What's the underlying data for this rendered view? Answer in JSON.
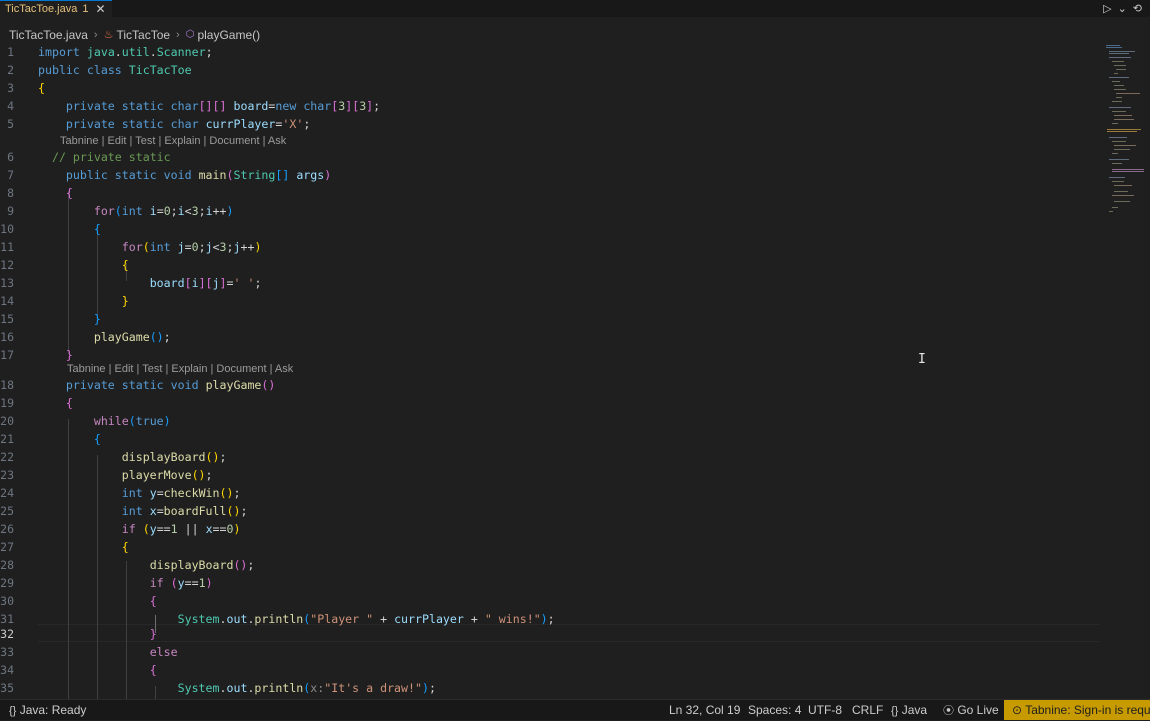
{
  "tab": {
    "title": "TicTacToe.java",
    "badge": "1",
    "close": "✕"
  },
  "toolbar": {
    "run_icon": "▷",
    "dropdown_icon": "⌄",
    "history_icon": "⟲"
  },
  "breadcrumb": {
    "file": "TicTacToe.java",
    "class": "TicTacToe",
    "method": "playGame()"
  },
  "codelens": "Tabnine | Edit | Test | Explain | Document | Ask",
  "status": {
    "java_state": "Java: Ready",
    "position": "Ln 32, Col 19",
    "spaces": "Spaces: 4",
    "encoding": "UTF-8",
    "eol": "CRLF",
    "language": "Java",
    "go_live": "Go Live",
    "tabnine": "Tabnine: Sign-in is required"
  },
  "code_lines": [
    {
      "n": "1",
      "text": "import java.util.Scanner;"
    },
    {
      "n": "2",
      "text": "public class TicTacToe"
    },
    {
      "n": "3",
      "text": "{"
    },
    {
      "n": "4",
      "text": "    private static char[][] board=new char[3][3];"
    },
    {
      "n": "5",
      "text": "    private static char currPlayer='X';"
    },
    {
      "n": "6",
      "text": "  // private static"
    },
    {
      "n": "7",
      "text": "    public static void main(String[] args)"
    },
    {
      "n": "8",
      "text": "    {"
    },
    {
      "n": "9",
      "text": "        for(int i=0;i<3;i++)"
    },
    {
      "n": "10",
      "text": "        {"
    },
    {
      "n": "11",
      "text": "            for(int j=0;j<3;j++)"
    },
    {
      "n": "12",
      "text": "            {"
    },
    {
      "n": "13",
      "text": "                board[i][j]=' ';"
    },
    {
      "n": "14",
      "text": "            }"
    },
    {
      "n": "15",
      "text": "        }"
    },
    {
      "n": "16",
      "text": "        playGame();"
    },
    {
      "n": "17",
      "text": "    }"
    },
    {
      "n": "18",
      "text": "    private static void playGame()"
    },
    {
      "n": "19",
      "text": "    {"
    },
    {
      "n": "20",
      "text": "        while(true)"
    },
    {
      "n": "21",
      "text": "        {"
    },
    {
      "n": "22",
      "text": "            displayBoard();"
    },
    {
      "n": "23",
      "text": "            playerMove();"
    },
    {
      "n": "24",
      "text": "            int y=checkWin();"
    },
    {
      "n": "25",
      "text": "            int x=boardFull();"
    },
    {
      "n": "26",
      "text": "            if (y==1 || x==0)"
    },
    {
      "n": "27",
      "text": "            {"
    },
    {
      "n": "28",
      "text": "                displayBoard();"
    },
    {
      "n": "29",
      "text": "                if (y==1)"
    },
    {
      "n": "30",
      "text": "                {"
    },
    {
      "n": "31",
      "text": "                    System.out.println(\"Player \" + currPlayer + \" wins!\");"
    },
    {
      "n": "32",
      "text": "                }"
    },
    {
      "n": "33",
      "text": "                else"
    },
    {
      "n": "34",
      "text": "                {"
    },
    {
      "n": "35",
      "text": "                    System.out.println(x:\"It's a draw!\");"
    }
  ]
}
